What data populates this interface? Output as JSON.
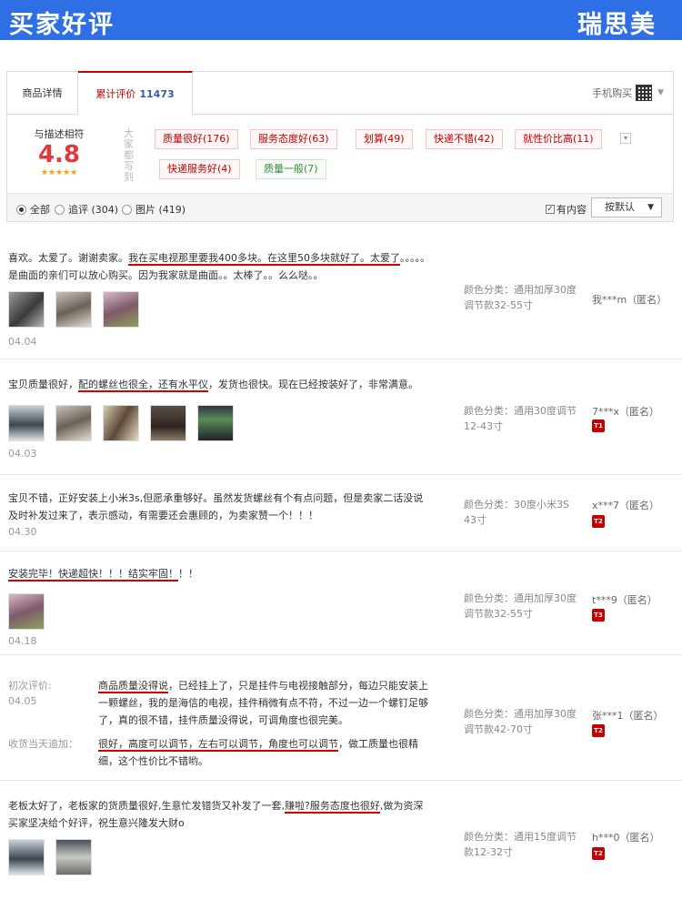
{
  "banner": {
    "left_text": "买家好评",
    "right_text": "瑞思美"
  },
  "tabs": {
    "detail": "商品详情",
    "review": "累计评价",
    "review_count": "11473",
    "mobile": "手机购买"
  },
  "score": {
    "label": "与描述相符",
    "value": "4.8",
    "stars": "★★★★★"
  },
  "vertical_label": "大家都写到",
  "tags": [
    {
      "text": "质量很好(176)",
      "type": "pos"
    },
    {
      "text": "服务态度好(63)",
      "type": "pos"
    },
    {
      "text": "划算(49)",
      "type": "pos"
    },
    {
      "text": "快递不错(42)",
      "type": "pos"
    },
    {
      "text": "就性价比高(11)",
      "type": "pos"
    },
    {
      "text": "快递服务好(4)",
      "type": "pos"
    },
    {
      "text": "质量一般(7)",
      "type": "neg"
    }
  ],
  "filters": {
    "all": "全部",
    "followup": "追评 (304)",
    "photos": "图片 (419)",
    "has_content": "有内容",
    "sort": "按默认"
  },
  "reviews": [
    {
      "text_parts": [
        "喜欢。太爱了。谢谢卖家。",
        "我在买电视那里要我400多块。在这里50多块就好了。太爱了",
        "。。。。。是曲面的亲们可以放心购买。因为我家就是曲面。。太棒了。。么么哒。。"
      ],
      "date": "04.04",
      "spec": "颜色分类：通用加厚30度调节款32-55寸",
      "user": "我***m（匿名）",
      "badge": ""
    },
    {
      "text_parts": [
        "宝贝质量很好，",
        "配的螺丝也很全，还有水平仪",
        "，发货也很快。现在已经按装好了，非常满意。"
      ],
      "date": "04.03",
      "spec": "颜色分类：通用30度调节12-43寸",
      "user": "7***x（匿名）",
      "badge": "T1"
    },
    {
      "text_parts": [
        "宝贝不错，正好安装上小米3s,但愿承重够好。虽然发货螺丝有个有点问题，但是卖家二话没说及时补发过来了，表示感动，有需要还会惠顾的，为卖家赞一个！！！",
        "",
        ""
      ],
      "date": "04.30",
      "spec": "颜色分类：30度小米3S 43寸",
      "user": "x***7（匿名）",
      "badge": "T2"
    },
    {
      "text_parts": [
        "",
        "安装完毕！快递超快！！！结实牢固！",
        "！！"
      ],
      "date": "04.18",
      "spec": "颜色分类：通用加厚30度调节款32-55寸",
      "user": "t***9（匿名）",
      "badge": "T3"
    },
    {
      "initial_label": "初次评价:",
      "date": "04.05",
      "initial_parts": [
        "商品质量没得说",
        "，已经挂上了，只是挂件与电视接触部分，每边只能安装上一颗螺丝，我的是海信的电视，挂件稍微有点不符，不过一边一个螺钉足够了，真的很不错，挂件质量没得说，可调角度也很完美。"
      ],
      "followup_label": "收货当天追加：",
      "followup_parts": [
        "很好，高度可以调节，左右可以调节，角度也可以调节",
        "，做工质量也很精细，这个性价比不错哟。"
      ],
      "spec": "颜色分类：通用加厚30度调节款42-70寸",
      "user": "张***1（匿名）",
      "badge": "T2"
    },
    {
      "text_parts": [
        "老板太好了，老板家的货质量很好,生意忙发错货又补发了一套,",
        "赚啦?服务态度也很好",
        ",做为资深买家坚决给个好评，祝生意兴隆发大财o"
      ],
      "date": "",
      "spec": "颜色分类：通用15度调节款12-32寸",
      "user": "h***0（匿名）",
      "badge": "T2"
    }
  ]
}
